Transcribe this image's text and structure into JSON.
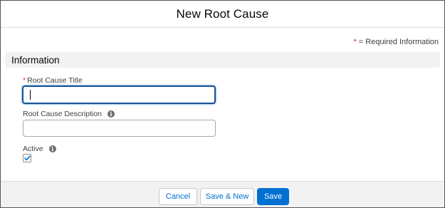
{
  "modal": {
    "title": "New Root Cause",
    "required_legend": {
      "star": "*",
      "text": "= Required Information"
    }
  },
  "section": {
    "title": "Information"
  },
  "fields": {
    "root_cause_title": {
      "label": "Root Cause Title",
      "required": true,
      "required_marker": "*",
      "value": ""
    },
    "root_cause_description": {
      "label": "Root Cause Description",
      "value": "",
      "info_icon": "info-icon"
    },
    "active": {
      "label": "Active",
      "checked": true,
      "info_icon": "info-icon"
    }
  },
  "info_glyph": "i",
  "footer": {
    "cancel_label": "Cancel",
    "save_new_label": "Save & New",
    "save_label": "Save"
  },
  "colors": {
    "brand": "#0070d2",
    "focus_border": "#1b5297",
    "required": "#c23934",
    "section_bg": "#f3f2f2"
  }
}
